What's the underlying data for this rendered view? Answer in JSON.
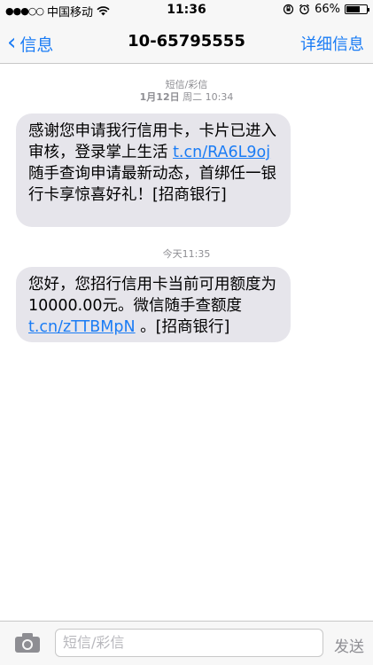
{
  "status_bar": {
    "signal": "●●●○○",
    "carrier": "中国移动",
    "time": "11:36",
    "battery": "66%",
    "battery_level": 0.66
  },
  "nav": {
    "back_label": "信息",
    "title": "10-65795555",
    "details_label": "详细信息"
  },
  "thread": {
    "type_label": "短信/彩信",
    "date1_bold": "1月12日",
    "date1_rest": " 周二 10:34",
    "msg1_a": "感谢您申请我行信用卡，卡片已进入审核，登录掌上生活 ",
    "msg1_link": "t.cn/RA6L9oj",
    "msg1_b": " 随手查询申请最新动态，首绑任一银行卡享惊喜好礼！[招商银行]",
    "date2": "今天11:35",
    "msg2_a": "您好，您招行信用卡当前可用额度为10000.00元。微信随手查额度 ",
    "msg2_link": "t.cn/zTTBMpN",
    "msg2_b": " 。[招商银行]"
  },
  "composer": {
    "placeholder": "短信/彩信",
    "send_label": "发送"
  }
}
